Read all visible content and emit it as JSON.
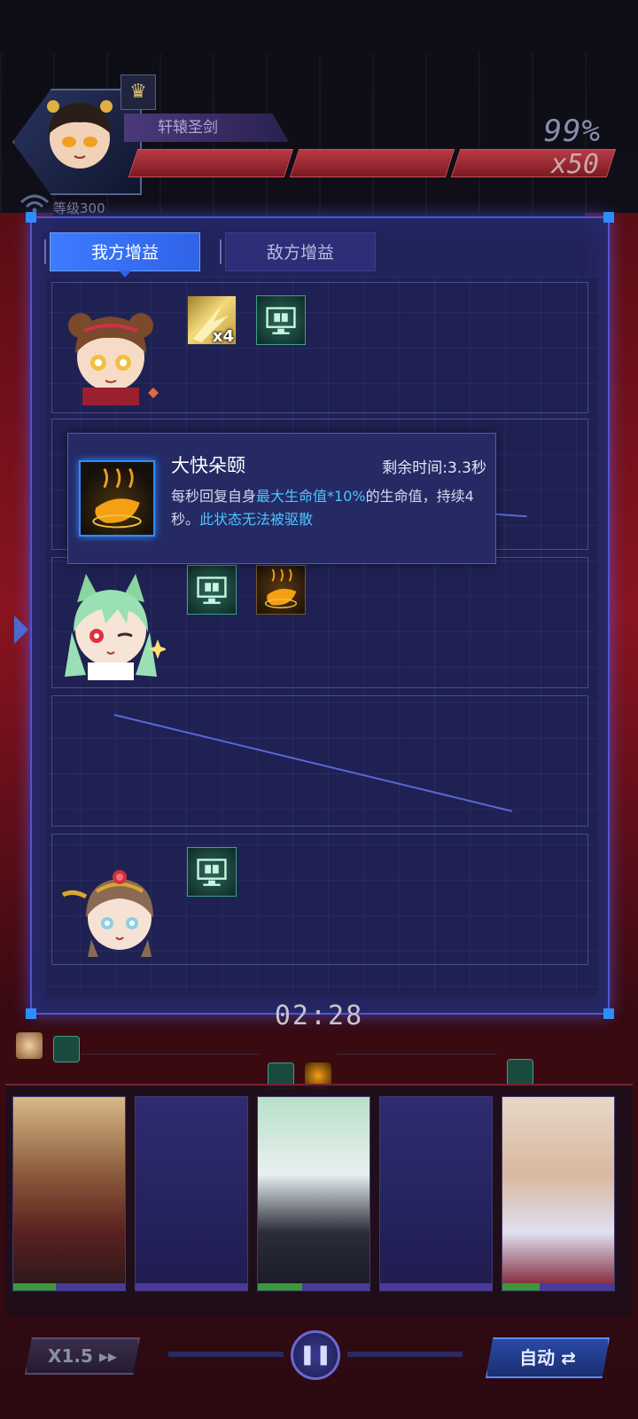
{
  "boss": {
    "name": "轩辕圣剑",
    "hp_percent_label": "99%",
    "hp_percent": 0.99,
    "hp_multiplier": "x50",
    "level_label": "等级300"
  },
  "panel": {
    "tabs": [
      {
        "label": "我方增益",
        "active": true
      },
      {
        "label": "敌方增益",
        "active": false
      }
    ]
  },
  "tooltip": {
    "title": "大快朵颐",
    "remaining_label": "剩余时间:",
    "remaining_value": "3.3秒",
    "desc_part1": "每秒回复自身",
    "desc_highlight1": "最大生命值*10%",
    "desc_part2": "的生命值，持续4秒。",
    "desc_highlight2": "此状态无法被驱散",
    "icon": "chili-flame-icon"
  },
  "slots": [
    {
      "hero": "bun-hair-girl",
      "buffs": [
        {
          "icon": "strength-burst-icon",
          "count": "x4"
        },
        {
          "icon": "monitor-book-icon"
        }
      ]
    },
    {
      "hero": "empty-covered",
      "buffs": []
    },
    {
      "hero": "green-fox-girl",
      "buffs": [
        {
          "icon": "monitor-book-icon"
        },
        {
          "icon": "chili-flame-icon"
        }
      ]
    },
    {
      "hero": "empty",
      "buffs": []
    },
    {
      "hero": "crowned-girl",
      "buffs": [
        {
          "icon": "monitor-book-icon"
        }
      ]
    }
  ],
  "timer": "02:28",
  "controls": {
    "speed_label": "X1.5 ▸▸",
    "pause_icon": "pause-icon",
    "auto_label": "自动 ⇄"
  },
  "colors": {
    "accent": "#2f8cff",
    "panel": "#22245e",
    "highlight": "#4cc4ff",
    "hp_red": "#b83a44"
  }
}
